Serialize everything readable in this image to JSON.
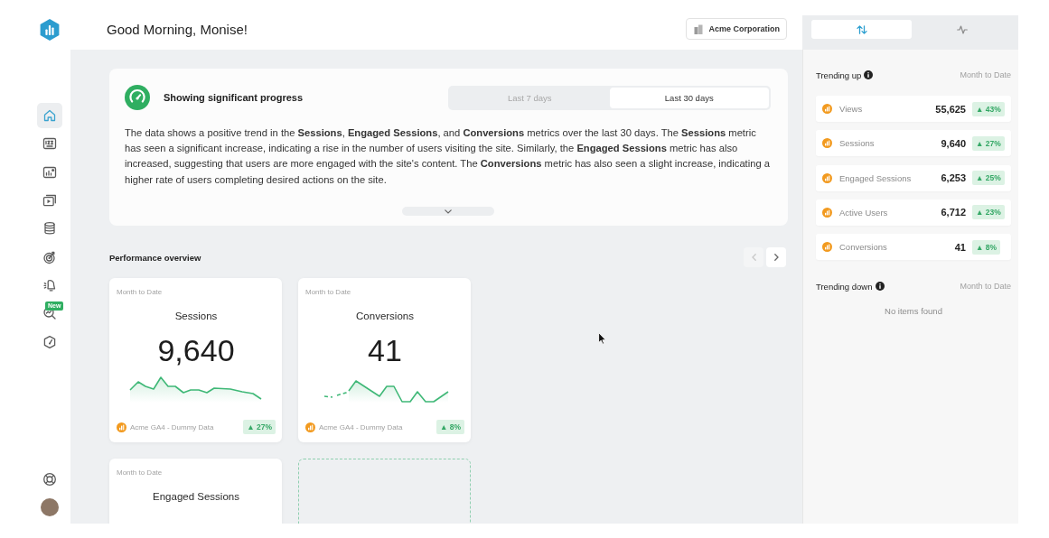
{
  "header": {
    "greeting": "Good Morning, Monise!",
    "workspace": "Acme Corporation"
  },
  "sidebar": {
    "items": [
      {
        "selected": true
      },
      {
        "selected": false
      },
      {
        "selected": false
      },
      {
        "selected": false
      },
      {
        "selected": false
      },
      {
        "selected": false
      },
      {
        "selected": false
      },
      {
        "selected": false,
        "badge": "New"
      },
      {
        "selected": false
      }
    ]
  },
  "insight": {
    "title": "Showing significant progress",
    "periods": [
      {
        "label": "Last 7 days",
        "selected": false
      },
      {
        "label": "Last 30 days",
        "selected": true
      }
    ],
    "text": "The data shows a positive trend in the **Sessions**, **Engaged Sessions**, and **Conversions** metrics over the last 30 days. The **Sessions** metric has seen a significant increase, indicating a rise in the number of users visiting the site. Similarly, the **Engaged Sessions** metric has also increased, suggesting that users are more engaged with the site's content. The **Conversions** metric has also seen a slight increase, indicating a higher rate of users completing desired actions on the site."
  },
  "performance": {
    "title": "Performance overview",
    "pager": [
      {
        "disabled": true
      },
      {
        "disabled": false
      }
    ],
    "cards": [
      {
        "kind": "metric",
        "period": "Month to Date",
        "title": "Sessions",
        "value": "9,640",
        "source": "Acme GA4 - Dummy Data",
        "change": "▲ 27%"
      },
      {
        "kind": "metric",
        "period": "Month to Date",
        "title": "Conversions",
        "value": "41",
        "source": "Acme GA4 - Dummy Data",
        "change": "▲ 8%"
      },
      {
        "kind": "metric",
        "period": "Month to Date",
        "title": "Engaged Sessions"
      },
      {
        "kind": "empty"
      }
    ]
  },
  "trends": {
    "tabs": [
      {
        "selected": true
      },
      {
        "selected": false
      }
    ],
    "up": {
      "title": "Trending up",
      "period": "Month to Date",
      "items": [
        {
          "label": "Views",
          "value": "55,625",
          "change": "▲ 43%"
        },
        {
          "label": "Sessions",
          "value": "9,640",
          "change": "▲ 27%"
        },
        {
          "label": "Engaged Sessions",
          "value": "6,253",
          "change": "▲ 25%"
        },
        {
          "label": "Active Users",
          "value": "6,712",
          "change": "▲ 23%"
        },
        {
          "label": "Conversions",
          "value": "41",
          "change": "▲ 8%"
        }
      ]
    },
    "down": {
      "title": "Trending down",
      "period": "Month to Date",
      "empty_text": "No items found"
    }
  }
}
